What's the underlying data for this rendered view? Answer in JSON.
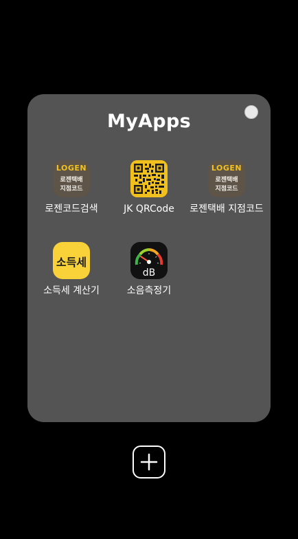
{
  "folder": {
    "title": "MyApps",
    "background_color": "#545454",
    "color_picker": "color-dot"
  },
  "apps": [
    {
      "label": "로젠코드검색",
      "icon": "logen-icon",
      "icon_text": {
        "brand": "LOGEN",
        "line1": "로젠택배",
        "line2": "지점코드"
      }
    },
    {
      "label": "JK QRCode",
      "icon": "qr-code-icon"
    },
    {
      "label": "로젠택배 지점코드",
      "icon": "logen-icon",
      "icon_text": {
        "brand": "LOGEN",
        "line1": "로젠택배",
        "line2": "지점코드"
      }
    },
    {
      "label": "소득세 계산기",
      "icon": "tax-icon",
      "icon_text": {
        "main": "소득세"
      }
    },
    {
      "label": "소음측정기",
      "icon": "sound-meter-icon",
      "icon_text": {
        "unit": "dB"
      }
    }
  ],
  "add_button": {
    "icon": "plus-icon"
  },
  "colors": {
    "screen_background": "#000000",
    "logen_brand": "#f4c21d",
    "qr_background": "#f2c01c",
    "tax_background": "#f9d23a"
  }
}
